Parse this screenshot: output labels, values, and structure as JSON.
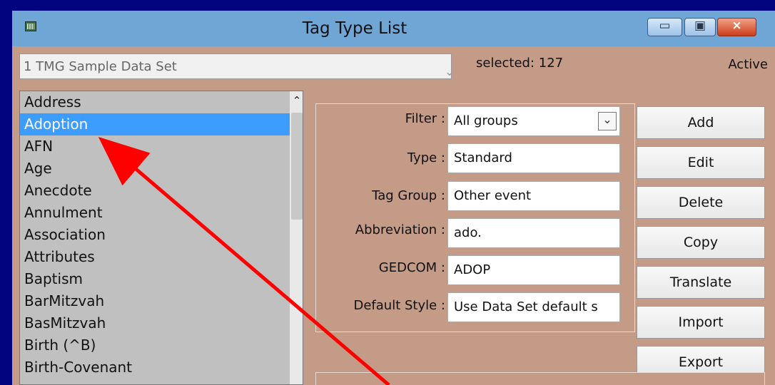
{
  "window": {
    "title": "Tag Type List",
    "accent": "#01047e"
  },
  "dataset": {
    "value": "1 TMG Sample Data Set",
    "selected_label": "selected: 127",
    "active_label": "Active"
  },
  "tag_list": {
    "items": [
      "Address",
      "Adoption",
      "AFN",
      "Age",
      "Anecdote",
      "Annulment",
      "Association",
      "Attributes",
      "Baptism",
      "BarMitzvah",
      "BasMitzvah",
      "Birth    (^B)",
      "Birth-Covenant"
    ],
    "selected_item": "Adoption"
  },
  "details": {
    "filter": {
      "label": "Filter :",
      "value": "All groups"
    },
    "type": {
      "label": "Type :",
      "value": "Standard"
    },
    "tag_group": {
      "label": "Tag Group :",
      "value": "Other event"
    },
    "abbreviation": {
      "label": "Abbreviation :",
      "value": "ado."
    },
    "gedcom": {
      "label": "GEDCOM :",
      "value": "ADOP"
    },
    "default_style": {
      "label": "Default Style :",
      "value": "Use Data Set default s"
    }
  },
  "buttons": {
    "add": "Add",
    "edit": "Edit",
    "delete": "Delete",
    "copy": "Copy",
    "translate": "Translate",
    "import": "Import",
    "export": "Export"
  },
  "icons": {
    "app": "table-icon",
    "minimize": "minimize-icon",
    "maximize": "maximize-icon",
    "close": "close-icon",
    "dropdown": "chevron-down-icon",
    "scroll": "chevron-up-icon"
  },
  "colors": {
    "titlebar": "#6fa6d6",
    "dialog": "#c49b86",
    "selection": "#3d9dff",
    "annotation": "#ff0000"
  }
}
